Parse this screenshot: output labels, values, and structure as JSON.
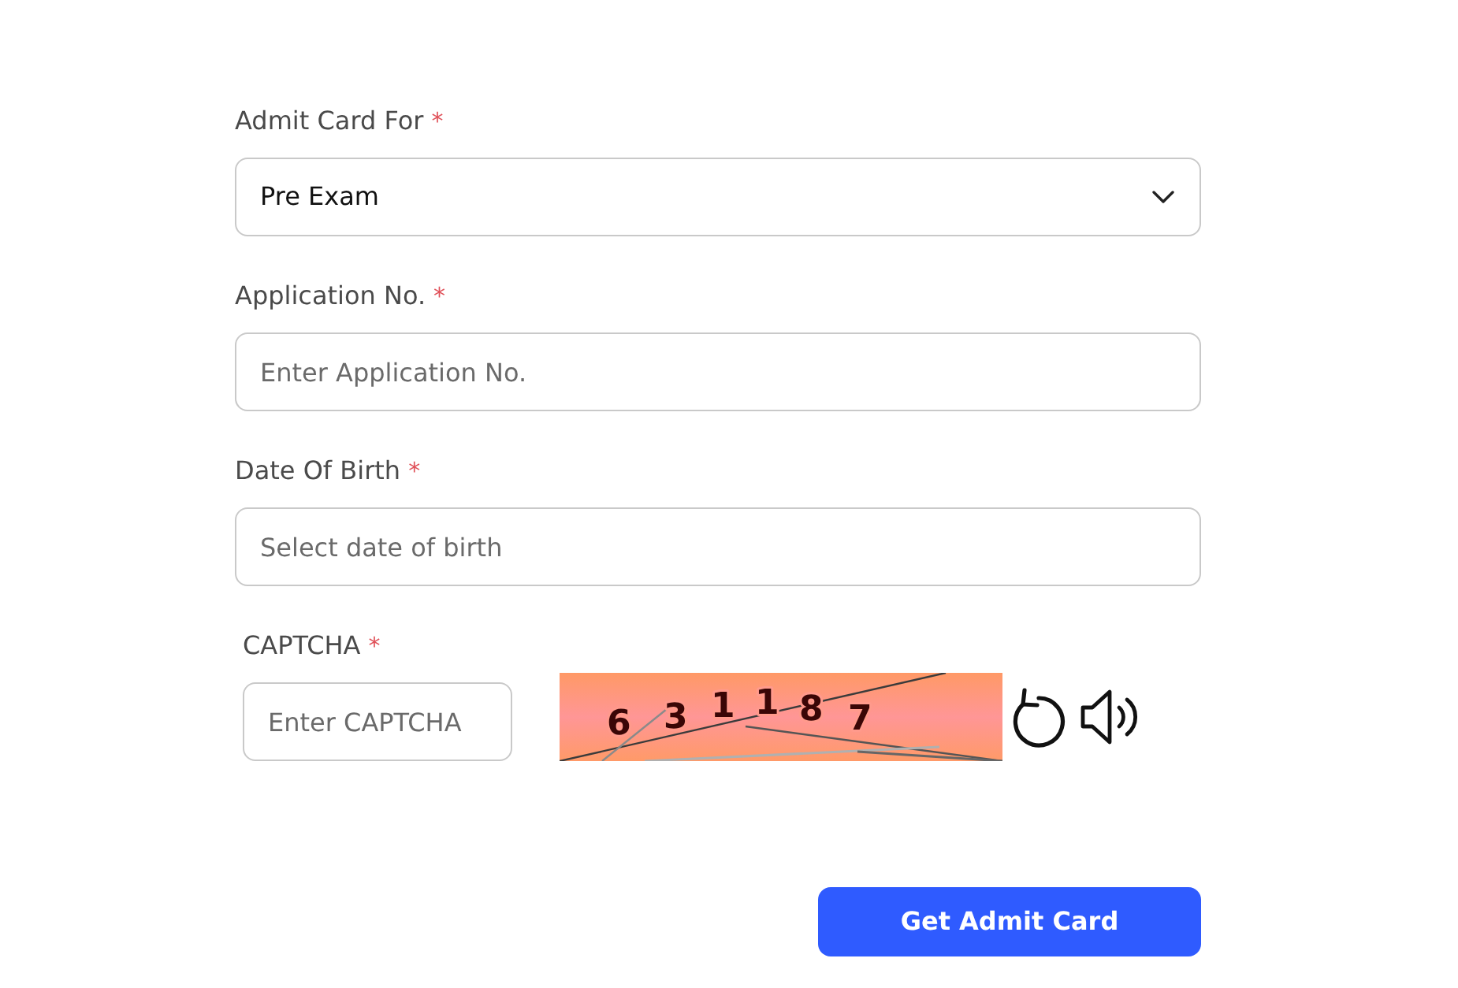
{
  "form": {
    "fields": [
      {
        "kind": "select",
        "label": "Admit Card For",
        "required_mark": "*",
        "value": "Pre Exam"
      },
      {
        "kind": "text",
        "label": "Application No.",
        "required_mark": "*",
        "placeholder": "Enter Application No."
      },
      {
        "kind": "text",
        "label": "Date Of Birth",
        "required_mark": "*",
        "placeholder": "Select date of birth"
      }
    ],
    "captcha": {
      "label": "CAPTCHA",
      "required_mark": "*",
      "placeholder": "Enter CAPTCHA",
      "characters": [
        "6",
        "3",
        "1",
        "1",
        "8",
        "7"
      ]
    },
    "submit_button": {
      "label": "Get Admit Card"
    }
  }
}
